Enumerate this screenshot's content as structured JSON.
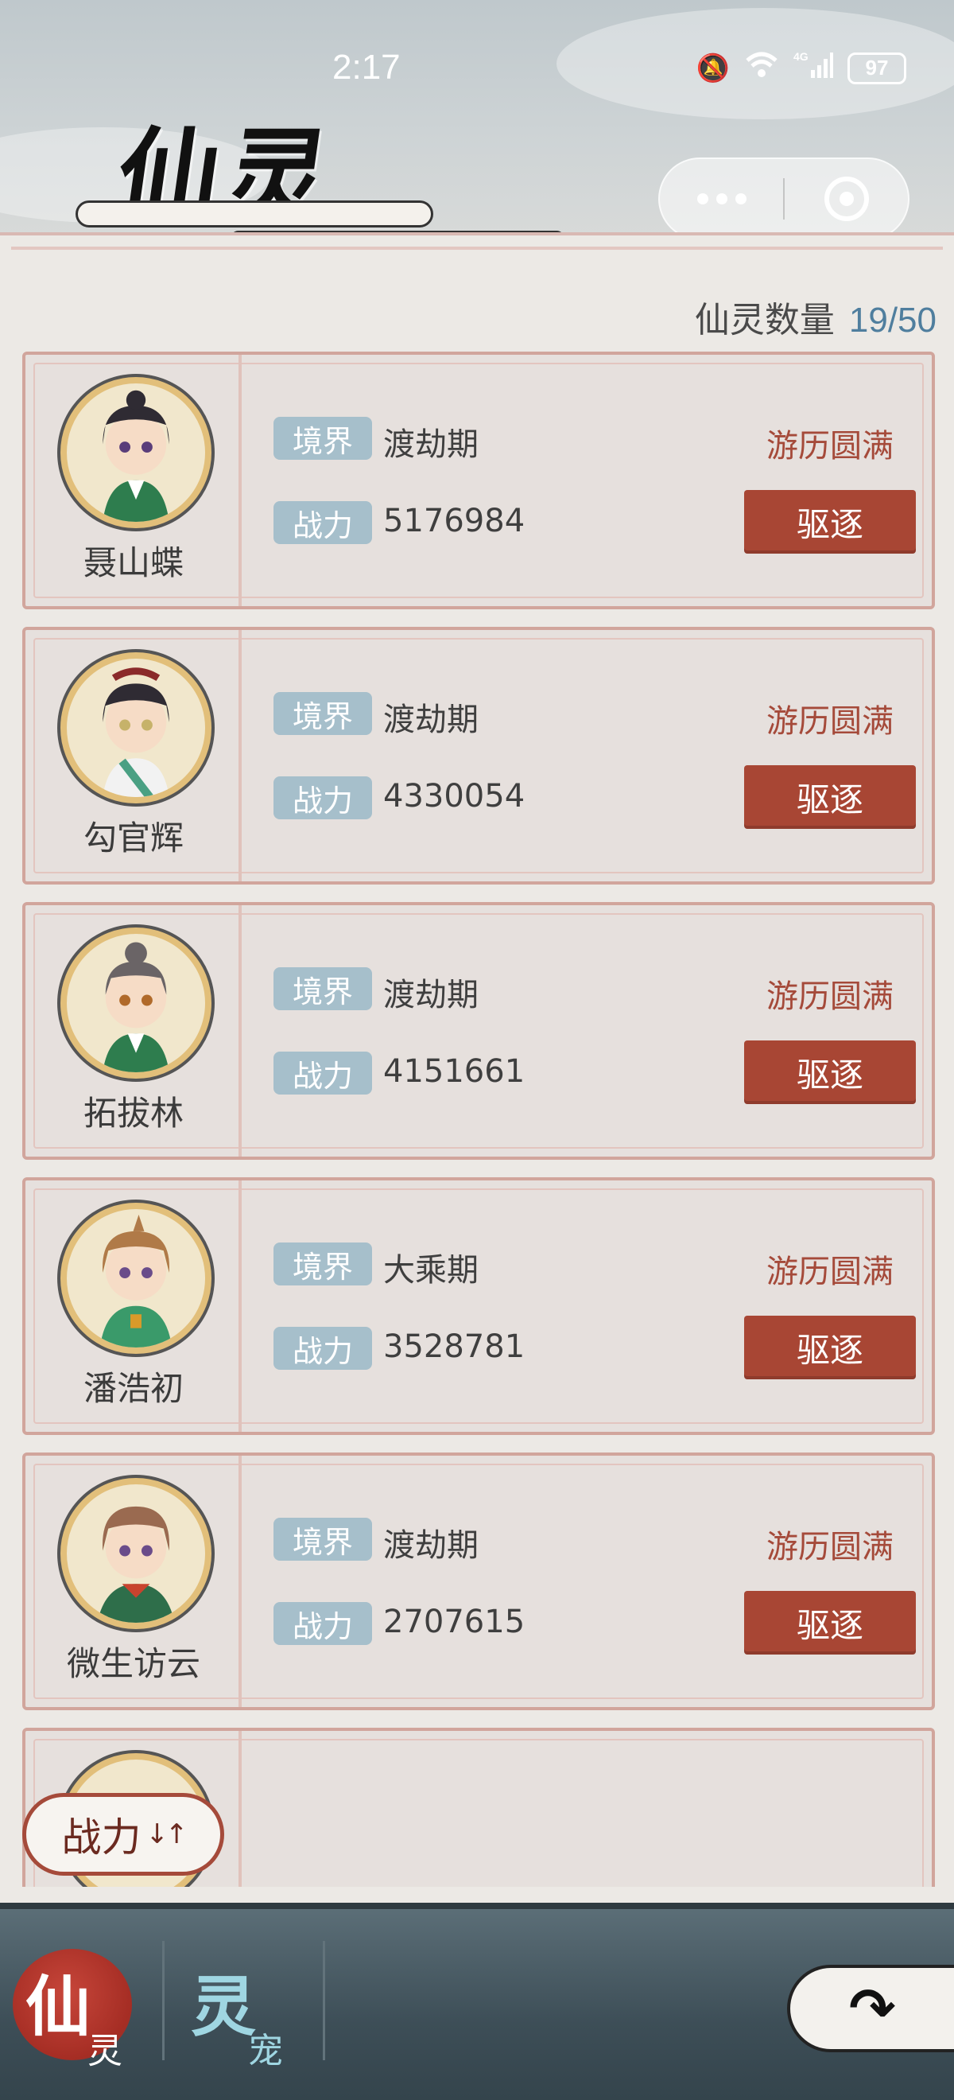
{
  "status_bar": {
    "time": "2:17",
    "network": "4G",
    "wifi_label": "6",
    "battery": "97"
  },
  "header": {
    "title": "仙灵"
  },
  "panel": {
    "count_label": "仙灵数量",
    "count_value": "19/50",
    "tag_realm": "境界",
    "tag_power": "战力",
    "action_label": "驱逐"
  },
  "spirits": [
    {
      "name": "聂山蝶",
      "realm": "渡劫期",
      "power": "5176984",
      "status": "游历圆满"
    },
    {
      "name": "勾官辉",
      "realm": "渡劫期",
      "power": "4330054",
      "status": "游历圆满"
    },
    {
      "name": "拓拔林",
      "realm": "渡劫期",
      "power": "4151661",
      "status": "游历圆满"
    },
    {
      "name": "潘浩初",
      "realm": "大乘期",
      "power": "3528781",
      "status": "游历圆满"
    },
    {
      "name": "微生访云",
      "realm": "渡劫期",
      "power": "2707615",
      "status": "游历圆满"
    }
  ],
  "sort": {
    "label": "战力",
    "arrows": "↓↑"
  },
  "tabs": [
    {
      "main": "仙",
      "sub": "灵",
      "active": true
    },
    {
      "main": "灵",
      "sub": "宠",
      "active": false
    }
  ],
  "colors": {
    "accent_red": "#a84634",
    "tag_blue": "#a6bfcb",
    "count_blue": "#4f7e9e"
  },
  "icons": {
    "back": "back-arrow-icon",
    "menu": "more-dots-icon",
    "close": "target-circle-icon"
  }
}
